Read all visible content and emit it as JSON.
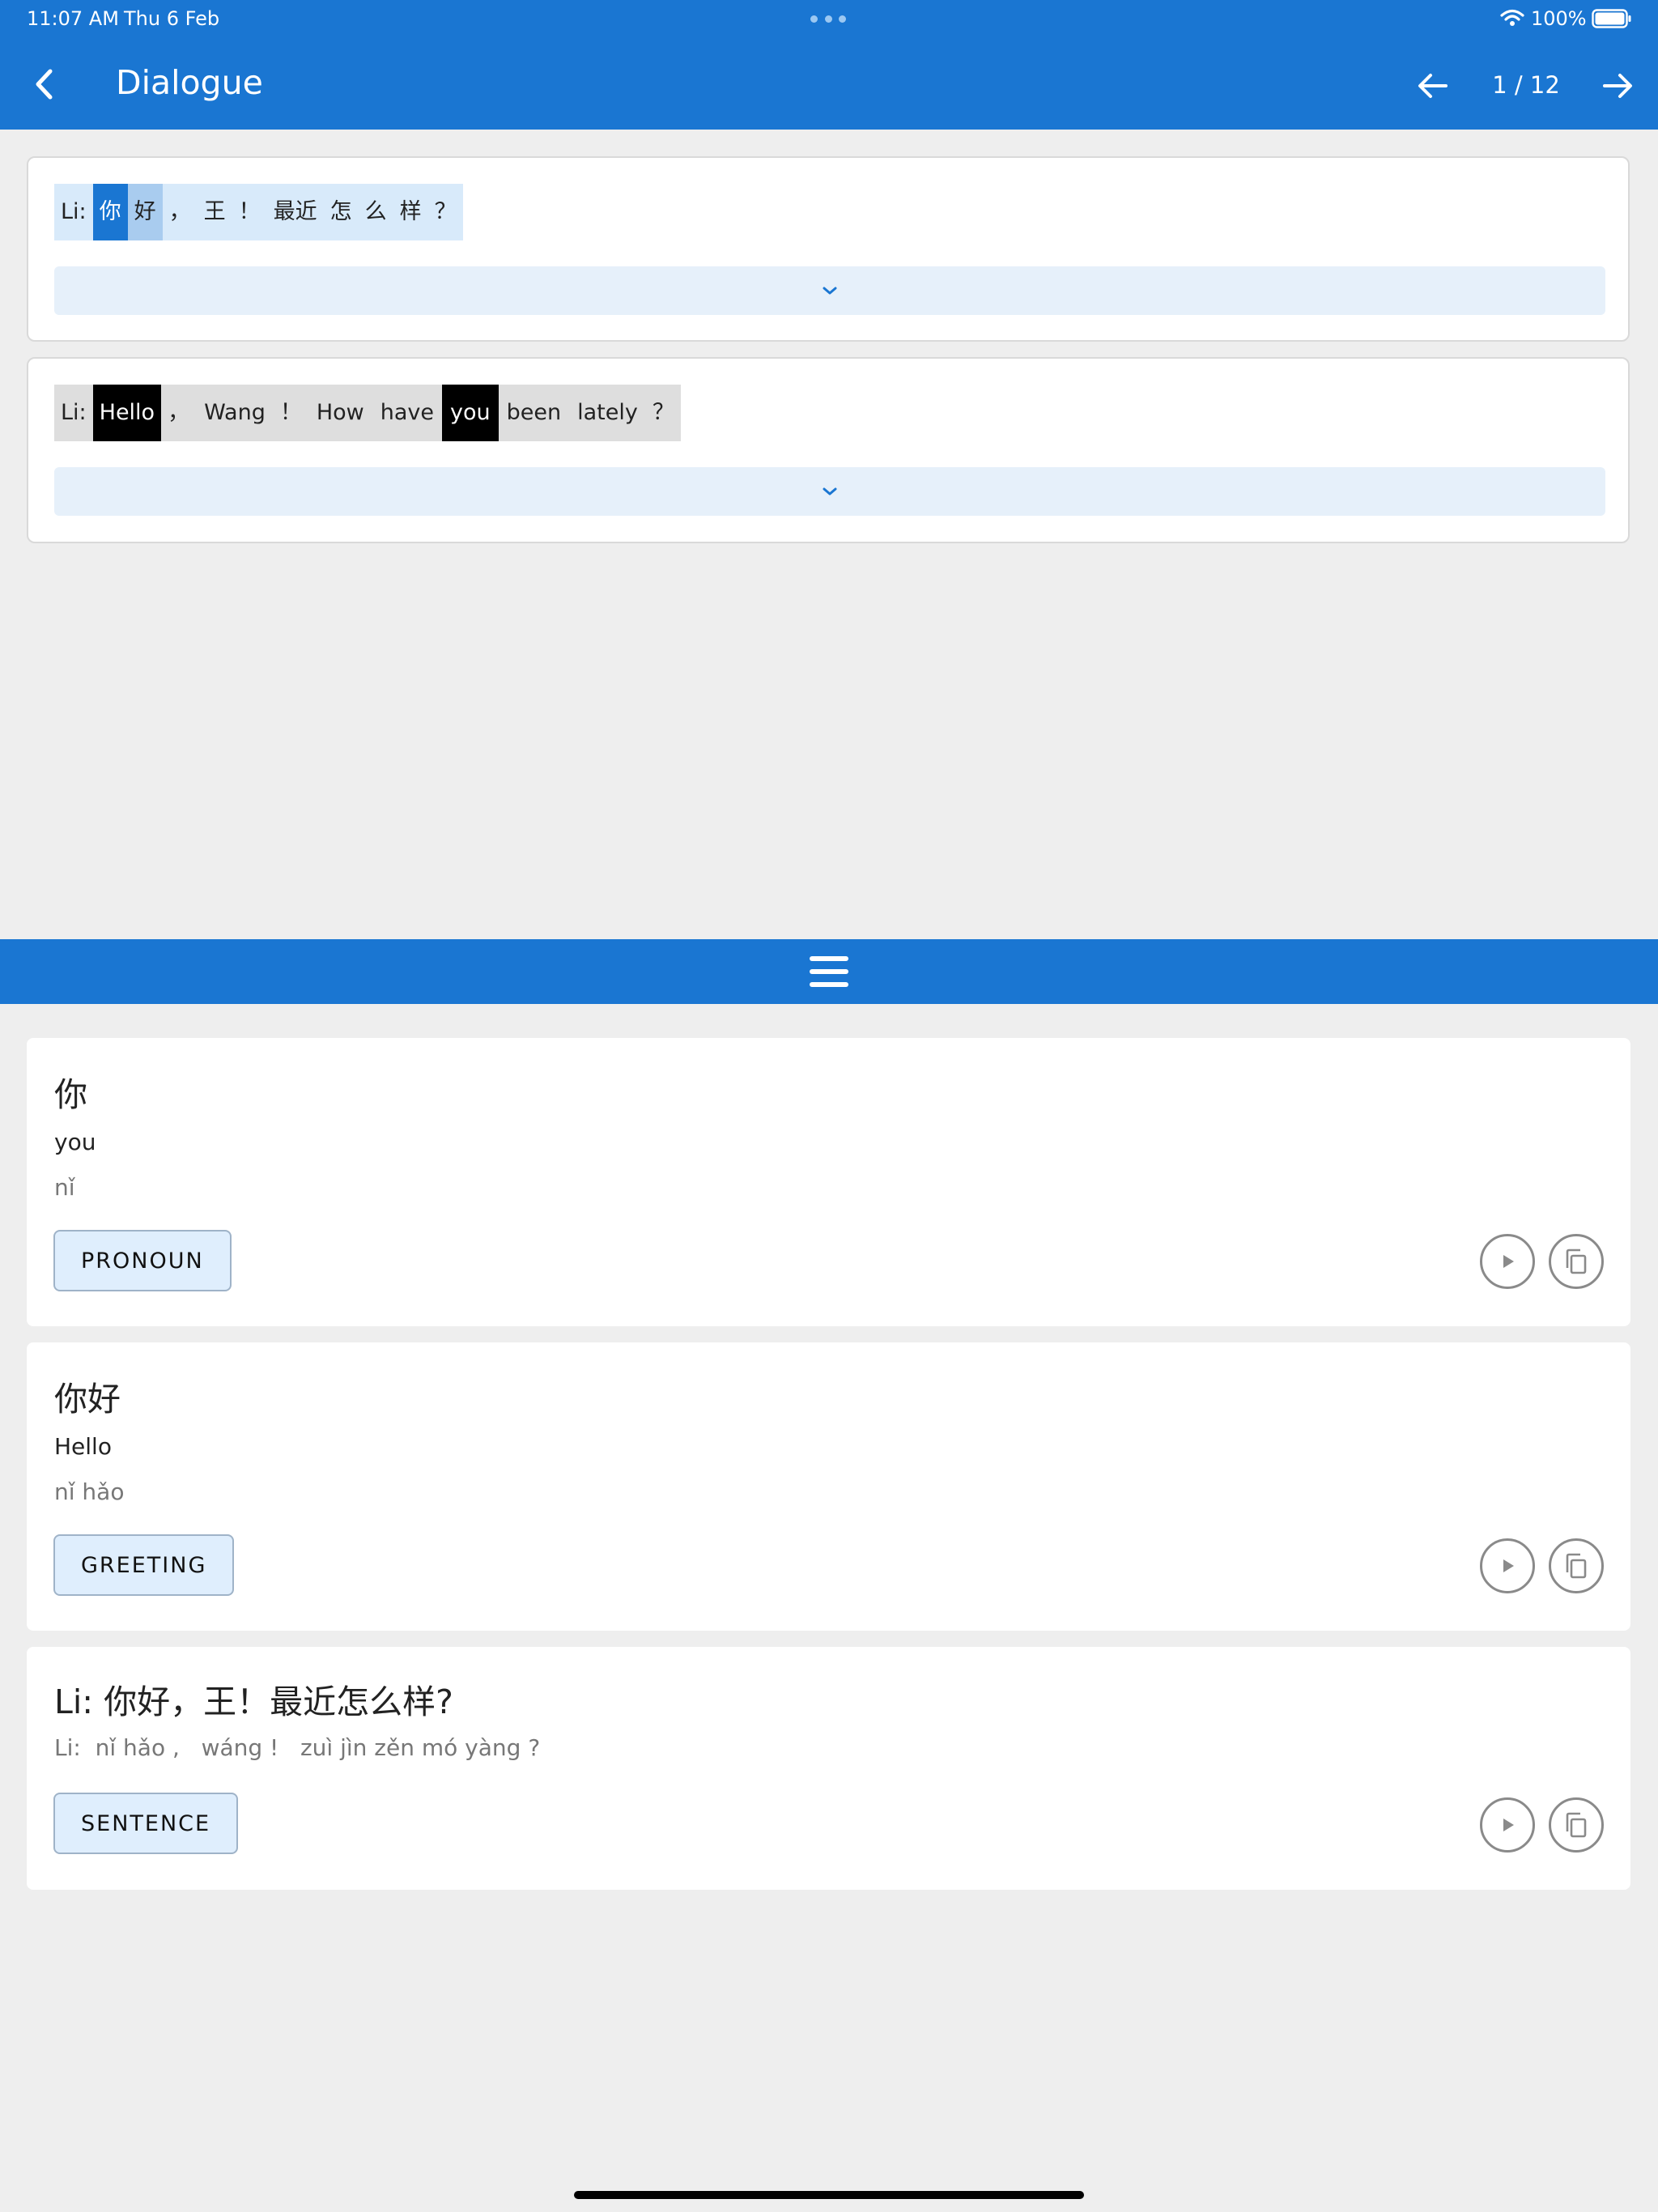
{
  "status_bar": {
    "time": "11:07 AM",
    "date": "Thu 6 Feb",
    "battery": "100%"
  },
  "header": {
    "title": "Dialogue",
    "page_counter": "1 / 12",
    "icons": [
      "chevron-left-icon",
      "arrow-left-icon",
      "arrow-right-icon"
    ]
  },
  "dialogue": {
    "chinese_tokens": [
      "Li:",
      "你",
      "好",
      "，",
      "王",
      "！",
      "最近",
      "怎",
      "么",
      "样",
      "？"
    ],
    "english_tokens": [
      "Li:",
      "Hello",
      "，",
      "Wang",
      "！",
      "How",
      "have",
      "you",
      "been",
      "lately",
      "？"
    ]
  },
  "words": [
    {
      "hanzi": "你",
      "meaning": "you",
      "pinyin": "nǐ",
      "part_of_speech": "PRONOUN"
    },
    {
      "hanzi": "你好",
      "meaning": "Hello",
      "pinyin": "nǐ hǎo",
      "part_of_speech": "GREETING"
    },
    {
      "sentence": "Li: 你好，王！最近怎么样?",
      "pinyin": "Li:  nǐ hǎo ,   wáng !   zuì jìn zěn mó yàng ?",
      "part_of_speech": "SENTENCE"
    }
  ],
  "colors": {
    "primary": "#1a76d2",
    "highlight_light": "#a9ccef",
    "chip_bg": "#dfeefd",
    "background": "#eeeeee"
  }
}
